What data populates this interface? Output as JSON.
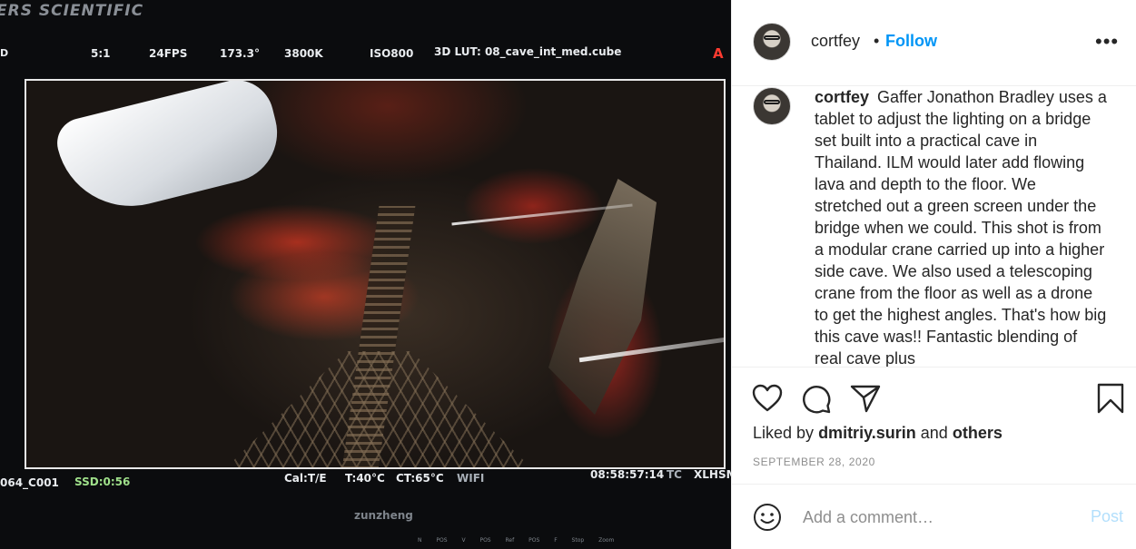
{
  "photo": {
    "monitor_brand": "ERS SCIENTIFIC",
    "hud_top": [
      "D",
      "5:1",
      "24FPS",
      "173.3°",
      "3800K",
      "ISO800",
      "3D LUT: 08_cave_int_med.cube",
      "A"
    ],
    "hud_bottom": [
      "064_C001",
      "SSD:0:56",
      "Cal:T/E",
      "T:40°C",
      "CT:65°C",
      "WIFI",
      "08:58:57:14",
      "TC",
      "XLHSM"
    ],
    "bezel_brand": "zunzheng",
    "bezel_labels": "N POS V POS Ref POS F Stop Zoom"
  },
  "post": {
    "username": "cortfey",
    "separator": "•",
    "follow_label": "Follow",
    "more_label": "•••",
    "caption_user": "cortfey",
    "caption_text": "Gaffer Jonathon Bradley uses a tablet to adjust the lighting on a bridge set built into a practical cave in Thailand. ILM would later add flowing lava and depth to the floor. We stretched out a green screen under the bridge when we could. This shot is from a modular crane carried up into a higher side cave. We also used a telescoping crane from the floor as well as a drone to get the highest angles. That's how big this cave was!! Fantastic blending of real cave plus",
    "likes_prefix": "Liked by",
    "likes_user": "dmitriy.surin",
    "likes_and": "and",
    "likes_others": "others",
    "date": "SEPTEMBER 28, 2020",
    "comment_placeholder": "Add a comment…",
    "post_label": "Post"
  },
  "icons": {
    "like": "heart-icon",
    "comment": "comment-icon",
    "share": "paper-plane-icon",
    "save": "bookmark-icon",
    "emoji": "smiley-icon"
  }
}
